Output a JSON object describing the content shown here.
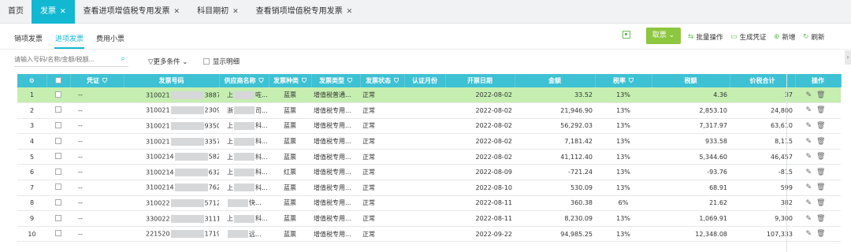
{
  "top_tabs": [
    {
      "label": "首页",
      "active": false,
      "closable": false
    },
    {
      "label": "发票",
      "active": true,
      "closable": true
    },
    {
      "label": "查看进项增值税专用发票",
      "active": false,
      "closable": true
    },
    {
      "label": "科目期初",
      "active": false,
      "closable": true
    },
    {
      "label": "查看销项增值税专用发票",
      "active": false,
      "closable": true
    }
  ],
  "sub_tabs": [
    {
      "label": "销项发票",
      "active": false
    },
    {
      "label": "进项发票",
      "active": true
    },
    {
      "label": "费用小票",
      "active": false
    }
  ],
  "toolbar": {
    "fetch_label": "取票",
    "fetch_caret": "⌄",
    "batch_label": "批量操作",
    "voucher_label": "生成凭证",
    "new_label": "新增",
    "refresh_label": "刷新"
  },
  "filters": {
    "search_placeholder": "请输入号码/名称/金额/税额...",
    "more_label": "更多条件",
    "detail_label": "显示明细"
  },
  "columns": [
    "序号",
    "",
    "凭证",
    "发票号码",
    "供应商名称",
    "发票种类",
    "发票类型",
    "发票状态",
    "认证月份",
    "开票日期",
    "金额",
    "税率",
    "税额",
    "价税合计",
    "操作"
  ],
  "rows": [
    {
      "no": "1",
      "voucher": "--",
      "inv_a": "310021",
      "inv_b": "3887721",
      "sup_a": "上",
      "sup_b": "咗...",
      "kind": "蓝票",
      "type": "增值税普通...",
      "status": "正常",
      "month": "",
      "date": "2022-08-02",
      "amount": "33.52",
      "rate": "13%",
      "tax": "4.36",
      "total": "37"
    },
    {
      "no": "2",
      "voucher": "--",
      "inv_a": "310021",
      "inv_b": "2309921",
      "sup_a": "浙",
      "sup_b": "司...",
      "kind": "蓝票",
      "type": "增值税专用...",
      "status": "正常",
      "month": "",
      "date": "2022-08-02",
      "amount": "21,946.90",
      "rate": "13%",
      "tax": "2,853.10",
      "total": "24,800"
    },
    {
      "no": "3",
      "voucher": "--",
      "inv_a": "310021",
      "inv_b": "935021",
      "sup_a": "上",
      "sup_b": "科...",
      "kind": "蓝票",
      "type": "增值税专用...",
      "status": "正常",
      "month": "",
      "date": "2022-08-02",
      "amount": "56,292.03",
      "rate": "13%",
      "tax": "7,317.97",
      "total": "63,610"
    },
    {
      "no": "4",
      "voucher": "--",
      "inv_a": "310021",
      "inv_b": "335721",
      "sup_a": "上",
      "sup_b": "科...",
      "kind": "蓝票",
      "type": "增值税专用...",
      "status": "正常",
      "month": "",
      "date": "2022-08-02",
      "amount": "7,181.42",
      "rate": "13%",
      "tax": "933.58",
      "total": "8,115"
    },
    {
      "no": "5",
      "voucher": "--",
      "inv_a": "3100214",
      "inv_b": "5821",
      "sup_a": "上",
      "sup_b": "科...",
      "kind": "蓝票",
      "type": "增值税专用...",
      "status": "正常",
      "month": "",
      "date": "2022-08-02",
      "amount": "41,112.40",
      "rate": "13%",
      "tax": "5,344.60",
      "total": "46,457"
    },
    {
      "no": "6",
      "voucher": "--",
      "inv_a": "3100214",
      "inv_b": "6321",
      "sup_a": "上",
      "sup_b": "科...",
      "kind": "红票",
      "type": "增值税专用...",
      "status": "正常",
      "month": "",
      "date": "2022-08-09",
      "amount": "-721.24",
      "rate": "13%",
      "tax": "-93.76",
      "total": "-815"
    },
    {
      "no": "7",
      "voucher": "--",
      "inv_a": "3100214",
      "inv_b": "7621",
      "sup_a": "上",
      "sup_b": "科...",
      "kind": "蓝票",
      "type": "增值税专用...",
      "status": "正常",
      "month": "",
      "date": "2022-08-10",
      "amount": "530.09",
      "rate": "13%",
      "tax": "68.91",
      "total": "599"
    },
    {
      "no": "8",
      "voucher": "--",
      "inv_a": "310022",
      "inv_b": "57121",
      "sup_a": "",
      "sup_b": "快...",
      "kind": "蓝票",
      "type": "增值税专用...",
      "status": "正常",
      "month": "",
      "date": "2022-08-11",
      "amount": "360.38",
      "rate": "6%",
      "tax": "21.62",
      "total": "382"
    },
    {
      "no": "9",
      "voucher": "--",
      "inv_a": "330022",
      "inv_b": "311121",
      "sup_a": "上",
      "sup_b": "科...",
      "kind": "蓝票",
      "type": "增值税专用...",
      "status": "正常",
      "month": "",
      "date": "2022-08-11",
      "amount": "8,230.09",
      "rate": "13%",
      "tax": "1,069.91",
      "total": "9,300"
    },
    {
      "no": "10",
      "voucher": "--",
      "inv_a": "221520",
      "inv_b": "171933",
      "sup_a": "",
      "sup_b": "远...",
      "kind": "蓝票",
      "type": "增值税专用...",
      "status": "正常",
      "month": "",
      "date": "2022-09-22",
      "amount": "94,985.25",
      "rate": "13%",
      "tax": "12,348.08",
      "total": "107,333"
    }
  ],
  "colors": {
    "accent": "#12b8d1",
    "header": "#3ec1d3",
    "selected_row": "#c5eeb0",
    "fetch_button": "#8dc63f"
  },
  "icons": {
    "filter": "funnel-icon",
    "search": "search-icon",
    "edit": "edit-icon",
    "delete": "trash-icon",
    "qr": "qr-icon"
  }
}
